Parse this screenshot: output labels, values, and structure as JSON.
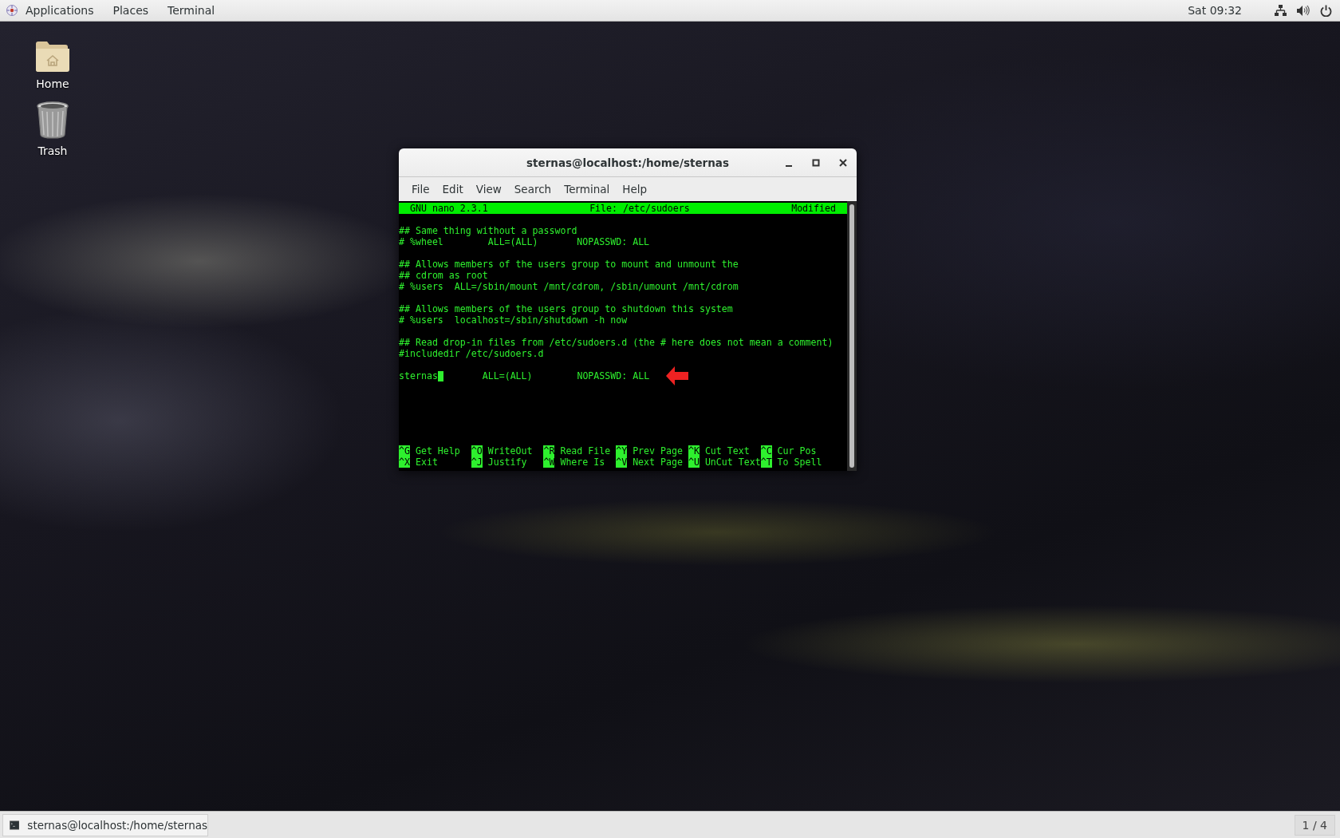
{
  "top_bar": {
    "menus": [
      "Applications",
      "Places",
      "Terminal"
    ],
    "clock": "Sat 09:32"
  },
  "desktop_icons": [
    {
      "kind": "home",
      "label": "Home"
    },
    {
      "kind": "trash",
      "label": "Trash"
    }
  ],
  "window": {
    "title": "sternas@localhost:/home/sternas",
    "menu": [
      "File",
      "Edit",
      "View",
      "Search",
      "Terminal",
      "Help"
    ],
    "nano": {
      "version": "GNU nano 2.3.1",
      "file": "File: /etc/sudoers",
      "status": "Modified",
      "lines": [
        {
          "kind": "blank"
        },
        {
          "kind": "text",
          "text": "## Same thing without a password"
        },
        {
          "kind": "text",
          "text": "# %wheel        ALL=(ALL)       NOPASSWD: ALL"
        },
        {
          "kind": "blank"
        },
        {
          "kind": "text",
          "text": "## Allows members of the users group to mount and unmount the"
        },
        {
          "kind": "text",
          "text": "## cdrom as root"
        },
        {
          "kind": "text",
          "text": "# %users  ALL=/sbin/mount /mnt/cdrom, /sbin/umount /mnt/cdrom"
        },
        {
          "kind": "blank"
        },
        {
          "kind": "text",
          "text": "## Allows members of the users group to shutdown this system"
        },
        {
          "kind": "text",
          "text": "# %users  localhost=/sbin/shutdown -h now"
        },
        {
          "kind": "blank"
        },
        {
          "kind": "text",
          "text": "## Read drop-in files from /etc/sudoers.d (the # here does not mean a comment)"
        },
        {
          "kind": "text",
          "text": "#includedir /etc/sudoers.d"
        },
        {
          "kind": "blank"
        },
        {
          "kind": "cursor",
          "before": "sternas",
          "after": "       ALL=(ALL)        NOPASSWD: ALL",
          "arrow": true
        }
      ],
      "shortcut_rows": [
        [
          {
            "key": "^G",
            "label": "Get Help"
          },
          {
            "key": "^O",
            "label": "WriteOut"
          },
          {
            "key": "^R",
            "label": "Read File"
          },
          {
            "key": "^Y",
            "label": "Prev Page"
          },
          {
            "key": "^K",
            "label": "Cut Text"
          },
          {
            "key": "^C",
            "label": "Cur Pos"
          }
        ],
        [
          {
            "key": "^X",
            "label": "Exit"
          },
          {
            "key": "^J",
            "label": "Justify"
          },
          {
            "key": "^W",
            "label": "Where Is"
          },
          {
            "key": "^V",
            "label": "Next Page"
          },
          {
            "key": "^U",
            "label": "UnCut Text"
          },
          {
            "key": "^T",
            "label": "To Spell"
          }
        ]
      ]
    }
  },
  "taskbar": {
    "window_button": "sternas@localhost:/home/sternas",
    "workspace": "1 / 4"
  }
}
